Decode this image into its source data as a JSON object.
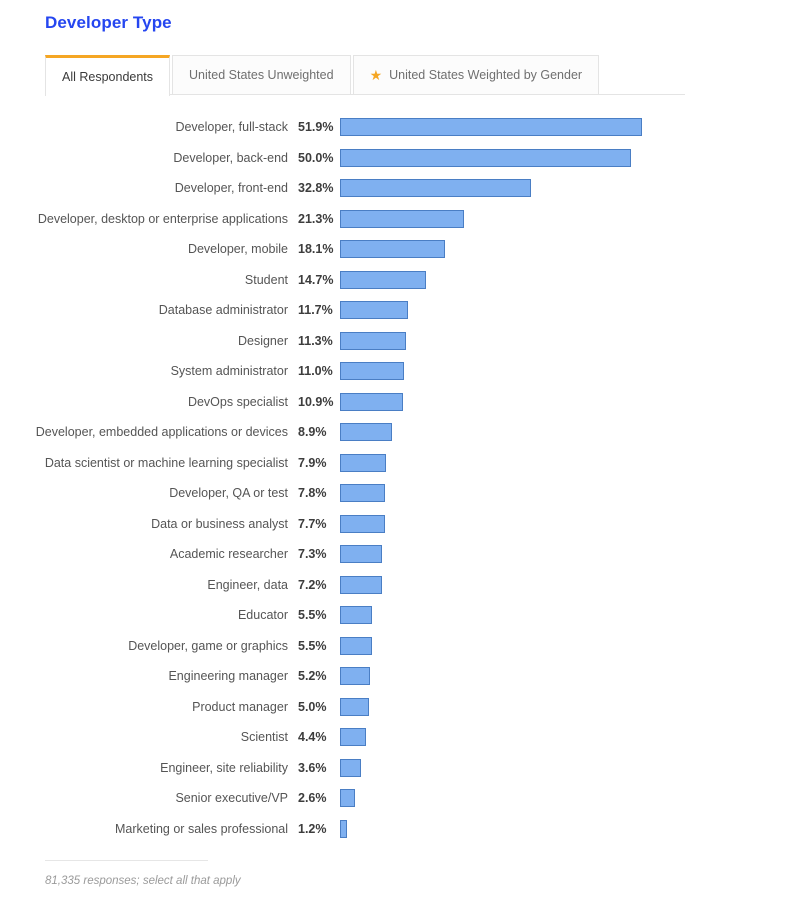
{
  "header": {
    "title": "Developer Type"
  },
  "tabs": [
    {
      "label": "All Respondents",
      "active": true,
      "icon": null
    },
    {
      "label": "United States Unweighted",
      "active": false,
      "icon": null
    },
    {
      "label": "United States Weighted by Gender",
      "active": false,
      "icon": "star-icon"
    }
  ],
  "footer": {
    "note": "81,335 responses; select all that apply"
  },
  "colors": {
    "title": "#2546f0",
    "bar_fill": "#7fb0f0",
    "bar_border": "#4a7ec4",
    "tab_active_accent": "#f5a623",
    "star": "#f5a623"
  },
  "chart_data": {
    "type": "bar",
    "orientation": "horizontal",
    "title": "Developer Type",
    "xlabel": "",
    "ylabel": "",
    "xlim": [
      0,
      51.9
    ],
    "grid": false,
    "legend": false,
    "value_suffix": "%",
    "categories": [
      "Developer, full-stack",
      "Developer, back-end",
      "Developer, front-end",
      "Developer, desktop or enterprise applications",
      "Developer, mobile",
      "Student",
      "Database administrator",
      "Designer",
      "System administrator",
      "DevOps specialist",
      "Developer, embedded applications or devices",
      "Data scientist or machine learning specialist",
      "Developer, QA or test",
      "Data or business analyst",
      "Academic researcher",
      "Engineer, data",
      "Educator",
      "Developer, game or graphics",
      "Engineering manager",
      "Product manager",
      "Scientist",
      "Engineer, site reliability",
      "Senior executive/VP",
      "Marketing or sales professional"
    ],
    "values": [
      51.9,
      50.0,
      32.8,
      21.3,
      18.1,
      14.7,
      11.7,
      11.3,
      11.0,
      10.9,
      8.9,
      7.9,
      7.8,
      7.7,
      7.3,
      7.2,
      5.5,
      5.5,
      5.2,
      5.0,
      4.4,
      3.6,
      2.6,
      1.2
    ],
    "value_labels": [
      "51.9%",
      "50.0%",
      "32.8%",
      "21.3%",
      "18.1%",
      "14.7%",
      "11.7%",
      "11.3%",
      "11.0%",
      "10.9%",
      "8.9%",
      "7.9%",
      "7.8%",
      "7.7%",
      "7.3%",
      "7.2%",
      "5.5%",
      "5.5%",
      "5.2%",
      "5.0%",
      "4.4%",
      "3.6%",
      "2.6%",
      "1.2%"
    ],
    "annotation": "81,335 responses; select all that apply"
  }
}
